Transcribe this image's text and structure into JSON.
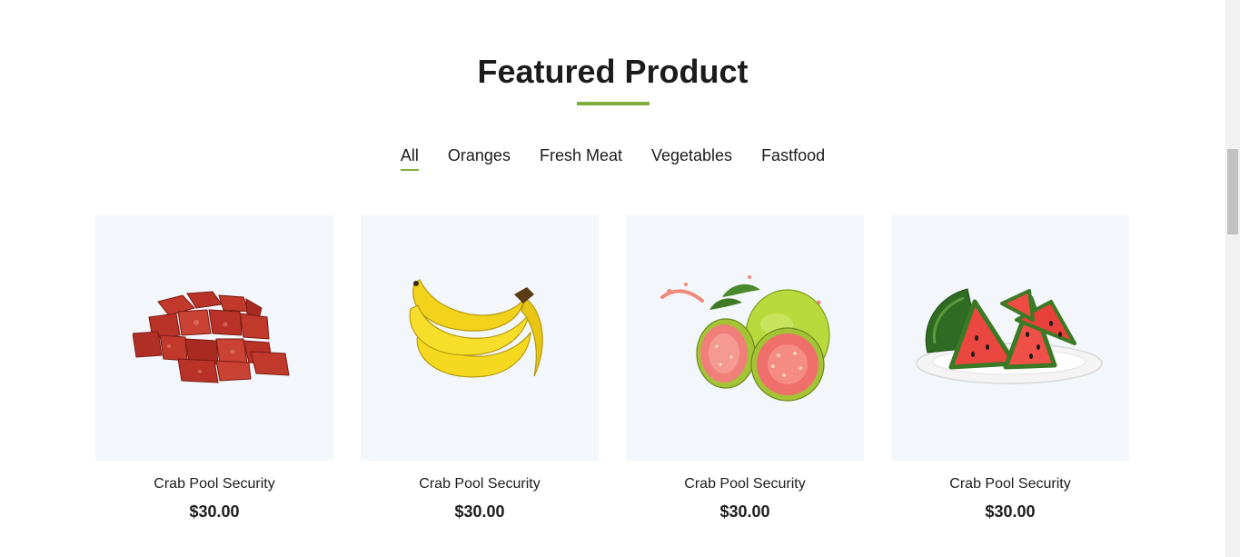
{
  "section": {
    "title": "Featured Product",
    "accent_color": "#7fad39"
  },
  "filters": [
    {
      "label": "All",
      "active": true
    },
    {
      "label": "Oranges",
      "active": false
    },
    {
      "label": "Fresh Meat",
      "active": false
    },
    {
      "label": "Vegetables",
      "active": false
    },
    {
      "label": "Fastfood",
      "active": false
    }
  ],
  "products": [
    {
      "image": "meat-cubes",
      "name": "Crab Pool Security",
      "price": "$30.00"
    },
    {
      "image": "bananas",
      "name": "Crab Pool Security",
      "price": "$30.00"
    },
    {
      "image": "guavas",
      "name": "Crab Pool Security",
      "price": "$30.00"
    },
    {
      "image": "watermelon-slices",
      "name": "Crab Pool Security",
      "price": "$30.00"
    }
  ]
}
